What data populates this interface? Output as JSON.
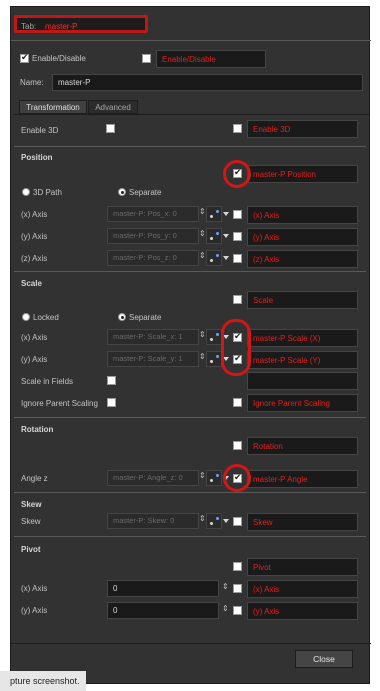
{
  "tab_field": {
    "label": "Tab:",
    "value": "master-P"
  },
  "enable": {
    "label": "Enable/Disable",
    "checked": true,
    "attr": "Enable/Disable"
  },
  "name": {
    "label": "Name:",
    "value": "master-P"
  },
  "tabs": [
    {
      "label": "Transformation"
    },
    {
      "label": "Advanced"
    }
  ],
  "enable3d": {
    "label": "Enable 3D",
    "attr": "Enable 3D"
  },
  "position": {
    "title": "Position",
    "attr": "master-P Position",
    "modes": [
      "3D Path",
      "Separate"
    ],
    "axes": [
      {
        "label": "(x) Axis",
        "func": "master-P: Pos_x: 0",
        "attr": "(x) Axis"
      },
      {
        "label": "(y) Axis",
        "func": "master-P: Pos_y: 0",
        "attr": "(y) Axis"
      },
      {
        "label": "(z) Axis",
        "func": "master-P: Pos_z: 0",
        "attr": "(z) Axis"
      }
    ]
  },
  "scale": {
    "title": "Scale",
    "attr": "Scale",
    "modes": [
      "Locked",
      "Separate"
    ],
    "axes": [
      {
        "label": "(x) Axis",
        "func": "master-P: Scale_x: 1",
        "attr": "master-P Scale (X)"
      },
      {
        "label": "(y) Axis",
        "func": "master-P: Scale_y: 1",
        "attr": "master-P Scale (Y)"
      }
    ],
    "in_fields": "Scale in Fields",
    "ignore_parent": "Ignore Parent Scaling",
    "ignore_parent_attr": "Ignore Parent Scaling"
  },
  "rotation": {
    "title": "Rotation",
    "attr": "Rotation",
    "angle_label": "Angle z",
    "func": "master-P: Angle_z: 0",
    "angle_attr": "master-P Angle"
  },
  "skew": {
    "title": "Skew",
    "label": "Skew",
    "func": "master-P: Skew: 0",
    "attr": "Skew"
  },
  "pivot": {
    "title": "Pivot",
    "attr": "Pivot",
    "axes": [
      {
        "label": "(x) Axis",
        "value": "0",
        "attr": "(x) Axis"
      },
      {
        "label": "(y) Axis",
        "value": "0",
        "attr": "(y) Axis"
      }
    ]
  },
  "close_label": "Close",
  "caption": "pture screenshot.",
  "colors": {
    "panel": "#323232",
    "field": "#1a1a1a",
    "highlight_red": "#d31616",
    "attr_text": "#e02020"
  }
}
